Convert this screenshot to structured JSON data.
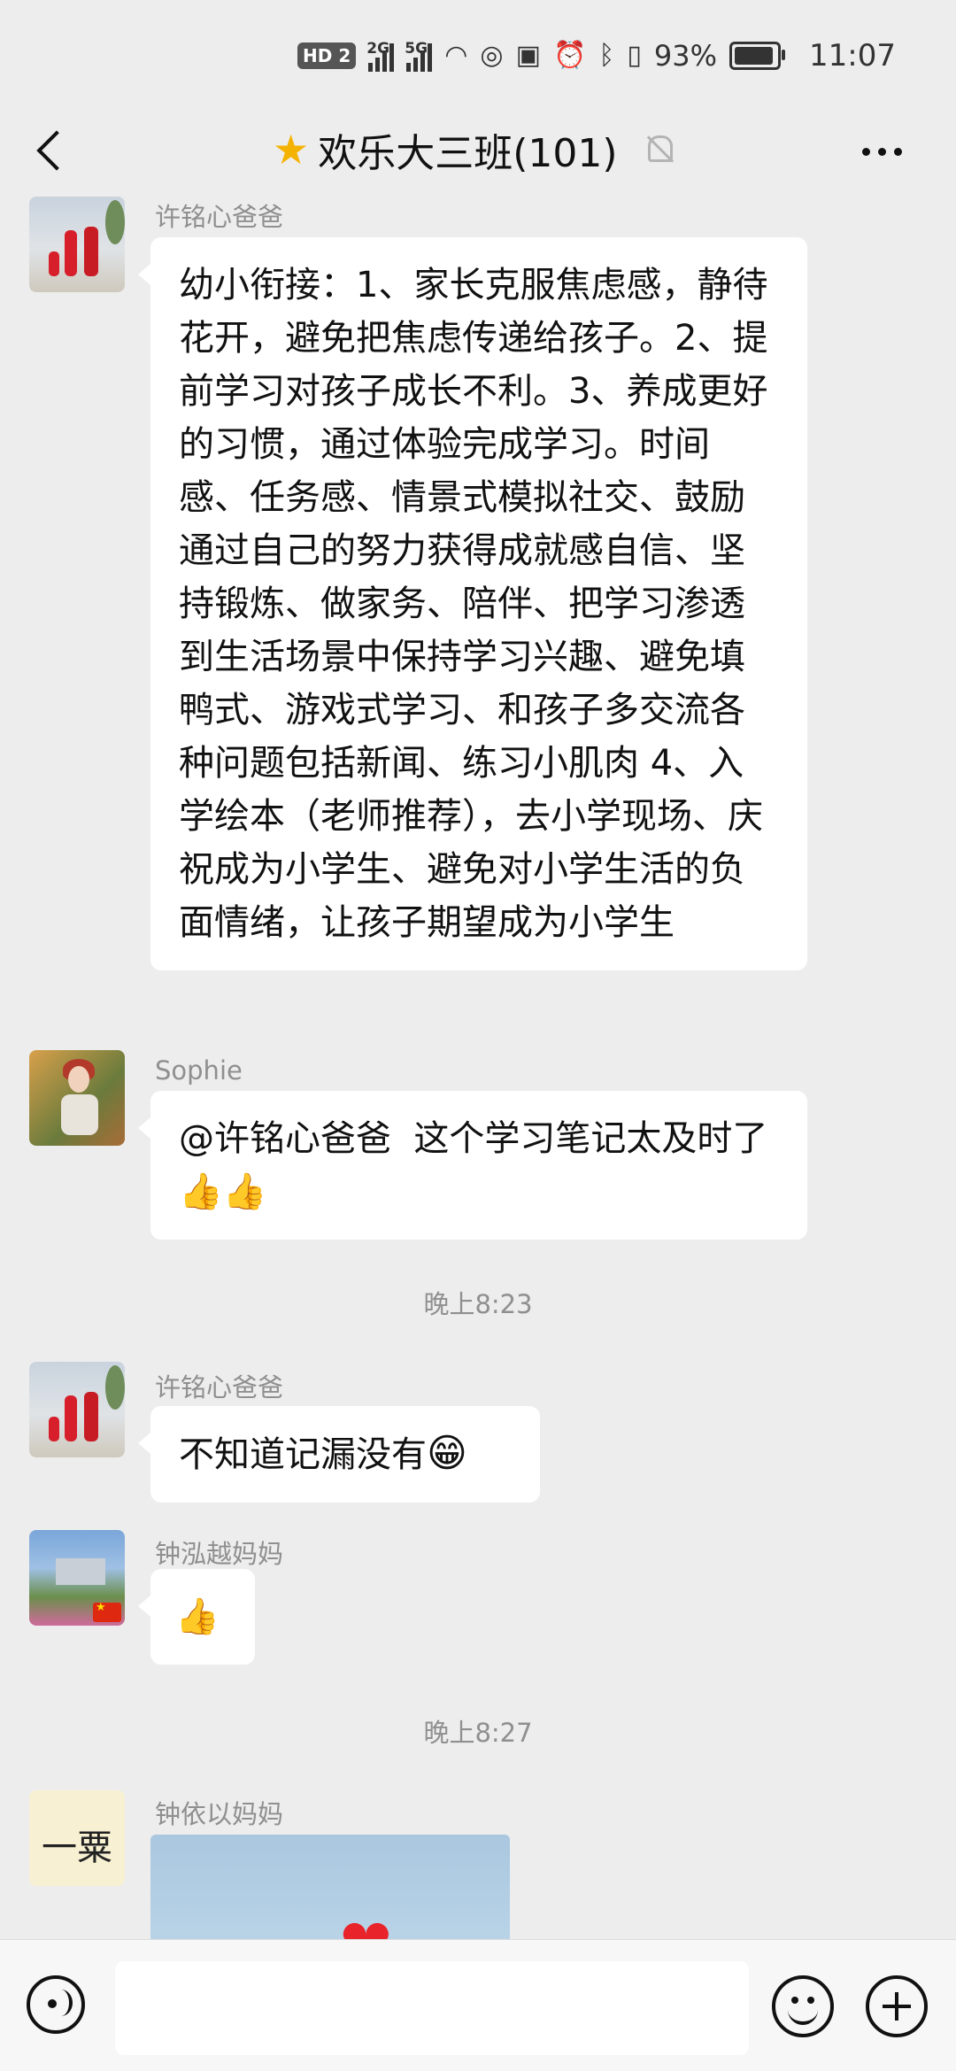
{
  "status_bar": {
    "hd_label": "HD",
    "sim_label": "2",
    "signal1_label": "2G",
    "signal2_label": "5G",
    "battery_percent_label": "93%",
    "battery_level": 0.93,
    "time": "11:07"
  },
  "header": {
    "title": "欢乐大三班(101)",
    "starred": true,
    "muted": true
  },
  "messages": [
    {
      "sender": "许铭心爸爸",
      "avatar": "family-photo",
      "text": "幼小衔接：1、家长克服焦虑感，静待花开，避免把焦虑传递给孩子。2、提前学习对孩子成长不利。3、养成更好的习惯，通过体验完成学习。时间感、任务感、情景式模拟社交、鼓励通过自己的努力获得成就感自信、坚持锻炼、做家务、陪伴、把学习渗透到生活场景中保持学习兴趣、避免填鸭式、游戏式学习、和孩子多交流各种问题包括新闻、练习小肌肉 4、入学绘本（老师推荐），去小学现场、庆祝成为小学生、避免对小学生活的负面情绪，让孩子期望成为小学生"
    },
    {
      "sender": "Sophie",
      "avatar": "sunflower-photo",
      "text": "@许铭心爸爸  这个学习笔记太及时了",
      "emoji": "👍👍"
    },
    {
      "timestamp": "晚上8:23"
    },
    {
      "sender": "许铭心爸爸",
      "avatar": "family-photo",
      "text": "不知道记漏没有",
      "emoji": "😁"
    },
    {
      "sender": "钟泓越妈妈",
      "avatar": "house-photo",
      "emoji": "👍"
    },
    {
      "timestamp": "晚上8:27"
    },
    {
      "sender": "钟依以妈妈",
      "avatar": "calligraphy",
      "avatar_text": "一粟",
      "image": "heart-image",
      "image_emoji": "❤"
    }
  ],
  "input_bar": {
    "voice_icon": "voice-icon",
    "emoji_icon": "emoji-icon",
    "plus_icon": "plus-icon",
    "input_value": ""
  },
  "colors": {
    "background": "#ededed",
    "bubble": "#ffffff",
    "meta_text": "#8f8f8f",
    "star": "#f5b301"
  }
}
